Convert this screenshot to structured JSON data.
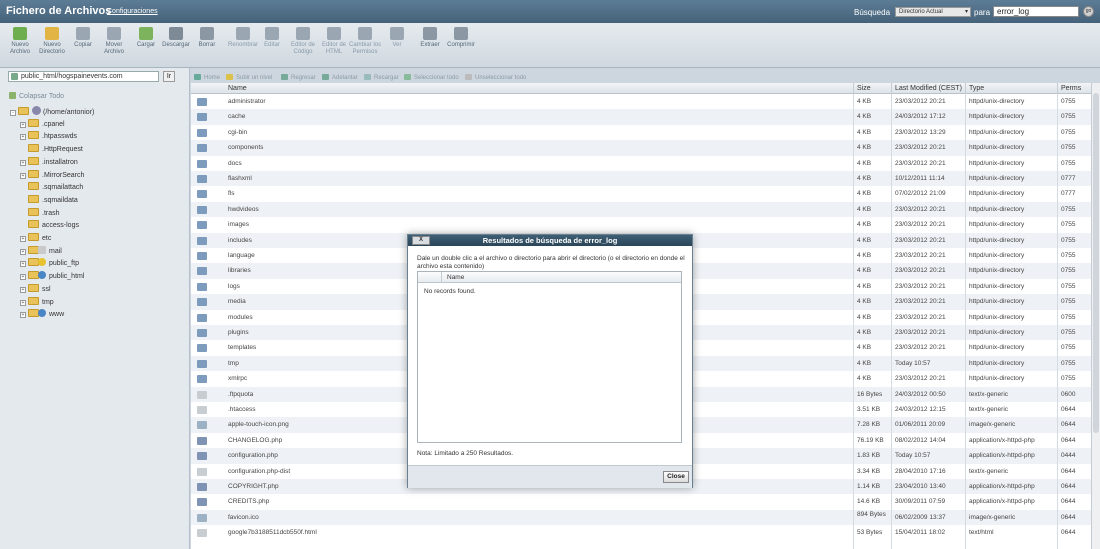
{
  "header": {
    "title": "Fichero de Archivos",
    "config_link": "Configuraciones",
    "search_label": "Búsqueda",
    "search_scope": "Directorio Actual",
    "para_label": "para",
    "search_value": "error_log",
    "go_label": "go"
  },
  "toolbar": {
    "buttons": [
      {
        "label": "Nuevo Archivo",
        "color": "#6fae4f"
      },
      {
        "label": "Nuevo Directorio",
        "color": "#e2b443"
      },
      {
        "label": "Copiar",
        "color": "#9aa6b2"
      },
      {
        "label": "Mover Archivo",
        "color": "#9aa6b2"
      },
      {
        "label": "Cargar",
        "color": "#7db35c"
      },
      {
        "label": "Descargar",
        "color": "#7e8a96"
      },
      {
        "label": "Borrar",
        "color": "#8b97a3"
      },
      {
        "label": "Renombrar",
        "color": "#9aa6b2"
      },
      {
        "label": "Editar",
        "color": "#9aa6b2"
      },
      {
        "label": "Editor de Código",
        "color": "#9aa6b2"
      },
      {
        "label": "Editor de HTML",
        "color": "#9aa6b2"
      },
      {
        "label": "Cambiar los Permisos",
        "color": "#9aa6b2"
      },
      {
        "label": "Ver",
        "color": "#9aa6b2"
      },
      {
        "label": "Extraer",
        "color": "#8b97a3"
      },
      {
        "label": "Comprimir",
        "color": "#8b97a3"
      }
    ]
  },
  "left": {
    "path_value": "public_html/hogspainevents.com",
    "path_go": "Ir",
    "collapse_label": "Colapsar Todo",
    "tree": [
      {
        "label": "(/home/antonior)",
        "kind": "home",
        "level": 0,
        "expander": "-"
      },
      {
        "label": ".cpanel",
        "kind": "folder",
        "level": 1,
        "expander": "+"
      },
      {
        "label": ".htpasswds",
        "kind": "folder",
        "level": 1,
        "expander": "+"
      },
      {
        "label": ".HttpRequest",
        "kind": "folder",
        "level": 1,
        "expander": ""
      },
      {
        "label": ".installatron",
        "kind": "folder",
        "level": 1,
        "expander": "+"
      },
      {
        "label": ".MirrorSearch",
        "kind": "folder",
        "level": 1,
        "expander": "+"
      },
      {
        "label": ".sqmailattach",
        "kind": "folder",
        "level": 1,
        "expander": ""
      },
      {
        "label": ".sqmaildata",
        "kind": "folder",
        "level": 1,
        "expander": ""
      },
      {
        "label": ".trash",
        "kind": "folder",
        "level": 1,
        "expander": ""
      },
      {
        "label": "access-logs",
        "kind": "folder",
        "level": 1,
        "expander": ""
      },
      {
        "label": "etc",
        "kind": "folder",
        "level": 1,
        "expander": "+"
      },
      {
        "label": "mail",
        "kind": "mail",
        "level": 1,
        "expander": "+"
      },
      {
        "label": "public_ftp",
        "kind": "ftp",
        "level": 1,
        "expander": "+"
      },
      {
        "label": "public_html",
        "kind": "globe",
        "level": 1,
        "expander": "+"
      },
      {
        "label": "ssl",
        "kind": "folder",
        "level": 1,
        "expander": "+"
      },
      {
        "label": "tmp",
        "kind": "folder",
        "level": 1,
        "expander": "+"
      },
      {
        "label": "www",
        "kind": "globe",
        "level": 1,
        "expander": "+"
      }
    ]
  },
  "navbar": {
    "home": "Home",
    "up": "Subir un nivel",
    "back": "Regresar",
    "forward": "Adelantar",
    "reload": "Recargar",
    "select_all": "Seleccionar todo",
    "unselect_all": "Unseleccionar todo"
  },
  "table": {
    "headers": {
      "name": "Name",
      "size": "Size",
      "modified": "Last Modified (CEST)",
      "type": "Type",
      "perms": "Perms"
    },
    "rows": [
      {
        "icon": "dir",
        "name": "administrator",
        "size": "4 KB",
        "modified": "23/03/2012 20:21",
        "type": "httpd/unix-directory",
        "perms": "0755"
      },
      {
        "icon": "dir",
        "name": "cache",
        "size": "4 KB",
        "modified": "24/03/2012 17:12",
        "type": "httpd/unix-directory",
        "perms": "0755"
      },
      {
        "icon": "dir",
        "name": "cgi-bin",
        "size": "4 KB",
        "modified": "23/03/2012 13:29",
        "type": "httpd/unix-directory",
        "perms": "0755"
      },
      {
        "icon": "dir",
        "name": "components",
        "size": "4 KB",
        "modified": "23/03/2012 20:21",
        "type": "httpd/unix-directory",
        "perms": "0755"
      },
      {
        "icon": "dir",
        "name": "docs",
        "size": "4 KB",
        "modified": "23/03/2012 20:21",
        "type": "httpd/unix-directory",
        "perms": "0755"
      },
      {
        "icon": "dir",
        "name": "flashxml",
        "size": "4 KB",
        "modified": "10/12/2011 11:14",
        "type": "httpd/unix-directory",
        "perms": "0777"
      },
      {
        "icon": "dir",
        "name": "fls",
        "size": "4 KB",
        "modified": "07/02/2012 21:09",
        "type": "httpd/unix-directory",
        "perms": "0777"
      },
      {
        "icon": "dir",
        "name": "hwdvideos",
        "size": "4 KB",
        "modified": "23/03/2012 20:21",
        "type": "httpd/unix-directory",
        "perms": "0755"
      },
      {
        "icon": "dir",
        "name": "images",
        "size": "4 KB",
        "modified": "23/03/2012 20:21",
        "type": "httpd/unix-directory",
        "perms": "0755"
      },
      {
        "icon": "dir",
        "name": "includes",
        "size": "4 KB",
        "modified": "23/03/2012 20:21",
        "type": "httpd/unix-directory",
        "perms": "0755"
      },
      {
        "icon": "dir",
        "name": "language",
        "size": "4 KB",
        "modified": "23/03/2012 20:21",
        "type": "httpd/unix-directory",
        "perms": "0755"
      },
      {
        "icon": "dir",
        "name": "libraries",
        "size": "4 KB",
        "modified": "23/03/2012 20:21",
        "type": "httpd/unix-directory",
        "perms": "0755"
      },
      {
        "icon": "dir",
        "name": "logs",
        "size": "4 KB",
        "modified": "23/03/2012 20:21",
        "type": "httpd/unix-directory",
        "perms": "0755"
      },
      {
        "icon": "dir",
        "name": "media",
        "size": "4 KB",
        "modified": "23/03/2012 20:21",
        "type": "httpd/unix-directory",
        "perms": "0755"
      },
      {
        "icon": "dir",
        "name": "modules",
        "size": "4 KB",
        "modified": "23/03/2012 20:21",
        "type": "httpd/unix-directory",
        "perms": "0755"
      },
      {
        "icon": "dir",
        "name": "plugins",
        "size": "4 KB",
        "modified": "23/03/2012 20:21",
        "type": "httpd/unix-directory",
        "perms": "0755"
      },
      {
        "icon": "dir",
        "name": "templates",
        "size": "4 KB",
        "modified": "23/03/2012 20:21",
        "type": "httpd/unix-directory",
        "perms": "0755"
      },
      {
        "icon": "dir",
        "name": "tmp",
        "size": "4 KB",
        "modified": "Today 10:57",
        "type": "httpd/unix-directory",
        "perms": "0755"
      },
      {
        "icon": "dir",
        "name": "xmlrpc",
        "size": "4 KB",
        "modified": "23/03/2012 20:21",
        "type": "httpd/unix-directory",
        "perms": "0755"
      },
      {
        "icon": "file",
        "name": ".ftpquota",
        "size": "16 Bytes",
        "modified": "24/03/2012 00:50",
        "type": "text/x-generic",
        "perms": "0600"
      },
      {
        "icon": "file",
        "name": ".htaccess",
        "size": "3.51 KB",
        "modified": "24/03/2012 12:15",
        "type": "text/x-generic",
        "perms": "0644"
      },
      {
        "icon": "img",
        "name": "apple-touch-icon.png",
        "size": "7.28 KB",
        "modified": "01/06/2011 20:09",
        "type": "image/x-generic",
        "perms": "0644"
      },
      {
        "icon": "php",
        "name": "CHANGELOG.php",
        "size": "76.19 KB",
        "modified": "08/02/2012 14:04",
        "type": "application/x-httpd-php",
        "perms": "0644"
      },
      {
        "icon": "php",
        "name": "configuration.php",
        "size": "1.83 KB",
        "modified": "Today 10:57",
        "type": "application/x-httpd-php",
        "perms": "0444"
      },
      {
        "icon": "file",
        "name": "configuration.php-dist",
        "size": "3.34 KB",
        "modified": "28/04/2010 17:16",
        "type": "text/x-generic",
        "perms": "0644"
      },
      {
        "icon": "php",
        "name": "COPYRIGHT.php",
        "size": "1.14 KB",
        "modified": "23/04/2010 13:40",
        "type": "application/x-httpd-php",
        "perms": "0644"
      },
      {
        "icon": "php",
        "name": "CREDITS.php",
        "size": "14.6 KB",
        "modified": "30/09/2011 07:59",
        "type": "application/x-httpd-php",
        "perms": "0644"
      },
      {
        "icon": "img",
        "name": "favicon.ico",
        "size": "894 Bytes",
        "modified": "06/02/2009 13:37",
        "type": "image/x-generic",
        "perms": "0644"
      },
      {
        "icon": "file",
        "name": "google7b3188511dcb550f.html",
        "size": "53 Bytes",
        "modified": "15/04/2011 18:02",
        "type": "text/html",
        "perms": "0644"
      }
    ]
  },
  "dialog": {
    "title": "Resultados de búsqueda de error_log",
    "close_x": "X",
    "info": "Dale un double clic a el archivo o directorio para abrir el directorio (o el directorio en donde el archivo esta contenido)",
    "col_name": "Name",
    "no_records": "No records found.",
    "note": "Nota: Limitado a 250 Resultados.",
    "close_button": "Close"
  }
}
